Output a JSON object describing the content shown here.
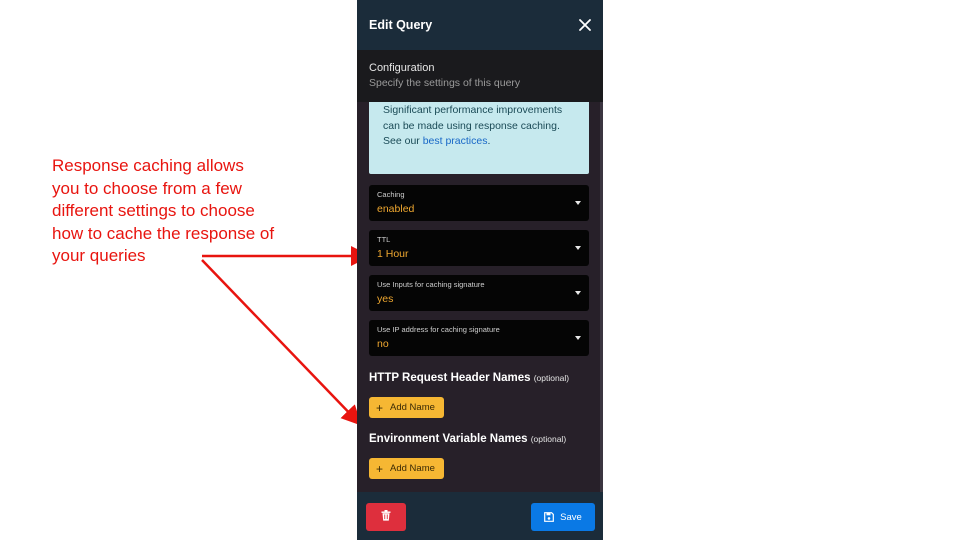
{
  "annotation": {
    "lines": [
      "Response caching allows",
      "you to choose from a few",
      "different settings to choose",
      "how to cache the response of",
      "your queries"
    ],
    "color": "#e8140f"
  },
  "panel": {
    "title": "Edit Query",
    "close_icon": "close-icon",
    "config": {
      "title": "Configuration",
      "subtitle": "Specify the settings of this query"
    },
    "info": {
      "text": "Significant performance improvements can be made using response caching. See our ",
      "link": "best practices",
      "suffix": "."
    },
    "selects": [
      {
        "label": "Caching",
        "value": "enabled"
      },
      {
        "label": "TTL",
        "value": "1 Hour"
      },
      {
        "label": "Use Inputs for caching signature",
        "value": "yes"
      },
      {
        "label": "Use IP address for caching signature",
        "value": "no"
      }
    ],
    "http_headers": {
      "title": "HTTP Request Header Names",
      "optional": "(optional)",
      "button": "Add Name"
    },
    "env_vars": {
      "title": "Environment Variable Names",
      "optional": "(optional)",
      "button": "Add Name"
    },
    "footer": {
      "delete_icon": "trash-icon",
      "save_icon": "floppy-disk-icon",
      "save_label": "Save"
    },
    "colors": {
      "header_bg": "#1b2c3a",
      "panel_bg": "#272029",
      "accent_value": "#f0a830",
      "add_button": "#f6b733",
      "delete_button": "#de2f3d",
      "save_button": "#0a79e5",
      "info_bg": "#c6e9ee"
    }
  }
}
